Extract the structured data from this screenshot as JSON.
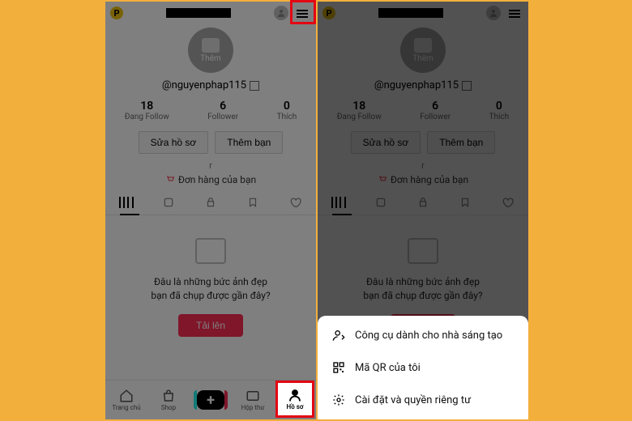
{
  "profile": {
    "badge": "P",
    "avatarLabel": "Thêm",
    "handle": "@nguyenphap115",
    "stats": {
      "following": {
        "value": "18",
        "label": "Đang Follow"
      },
      "followers": {
        "value": "6",
        "label": "Follower"
      },
      "likes": {
        "value": "0",
        "label": "Thích"
      }
    },
    "editBtn": "Sửa hồ sơ",
    "addFriendBtn": "Thêm bạn",
    "rMark": "r",
    "orders": "Đơn hàng của bạn",
    "emptyLine1": "Đâu là những bức ảnh đẹp",
    "emptyLine2": "bạn đã chụp được gần đây?",
    "uploadBtn": "Tải lên"
  },
  "nav": {
    "home": "Trang chủ",
    "shop": "Shop",
    "inbox": "Hộp thư",
    "profile": "Hồ sơ"
  },
  "sheet": {
    "creator": "Công cụ dành cho nhà sáng tạo",
    "qr": "Mã QR của tôi",
    "settings": "Cài đặt và quyền riêng tư"
  }
}
